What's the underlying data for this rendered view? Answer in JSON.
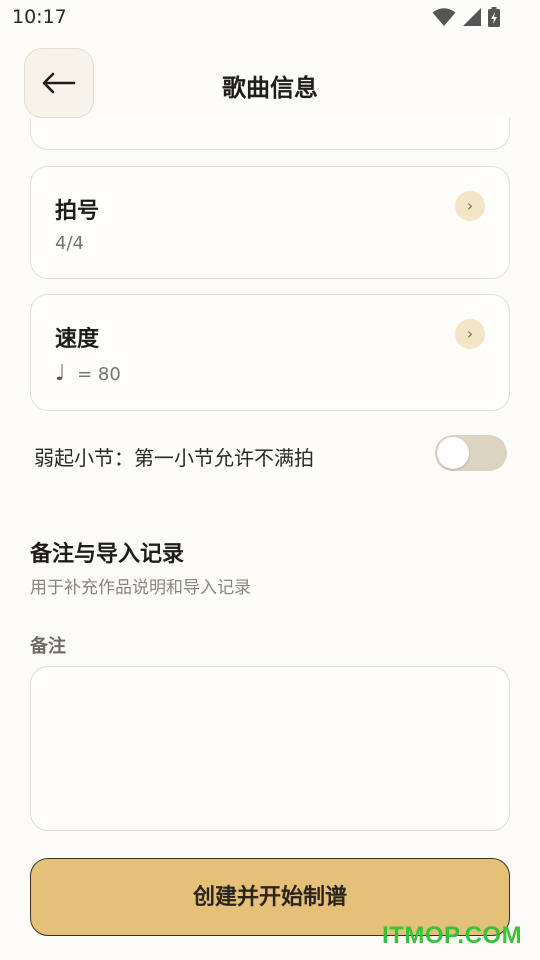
{
  "status_bar": {
    "time": "10:17"
  },
  "header": {
    "title": "歌曲信息",
    "back_icon": "arrow-left-icon"
  },
  "cards": {
    "time_signature": {
      "title": "拍号",
      "value": "4/4"
    },
    "tempo": {
      "title": "速度",
      "note_symbol": "♩",
      "value": "= 80"
    }
  },
  "pickup": {
    "label": "弱起小节：第一小节允许不满拍",
    "enabled": false
  },
  "notes_section": {
    "title": "备注与导入记录",
    "subtitle": "用于补充作品说明和导入记录",
    "field_label": "备注",
    "field_value": ""
  },
  "primary_button": {
    "label": "创建并开始制谱"
  },
  "watermark": "ITMOP.COM",
  "colors": {
    "accent": "#e4c078",
    "background": "#fdfcf8",
    "chevron_bg": "#f2e5c6"
  }
}
